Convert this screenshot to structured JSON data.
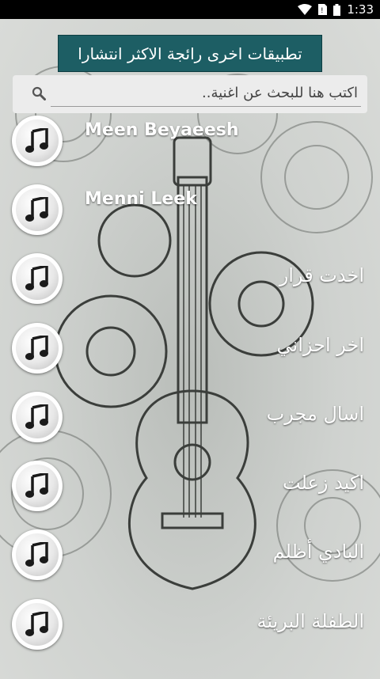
{
  "status_bar": {
    "time": "1:33",
    "icons": [
      "wifi-icon",
      "no-sim-icon",
      "battery-icon"
    ]
  },
  "banner": {
    "label": "تطبيقات اخرى رائجة الاكثر انتشارا"
  },
  "search": {
    "placeholder": "اكتب هنا للبحث عن اغنية..",
    "icon": "search-icon"
  },
  "songs": [
    {
      "title": "Meen Beyaeesh"
    },
    {
      "title": "Menni Leek"
    },
    {
      "title": "اخدت قرار"
    },
    {
      "title": "اخر احزاني"
    },
    {
      "title": "اسال مجرب"
    },
    {
      "title": "اكيد زعلت"
    },
    {
      "title": "البادي أظلم"
    },
    {
      "title": "الطفلة البريئة"
    }
  ],
  "colors": {
    "banner": "#1d5e64",
    "statusbar": "#000000",
    "text": "#ffffff"
  }
}
